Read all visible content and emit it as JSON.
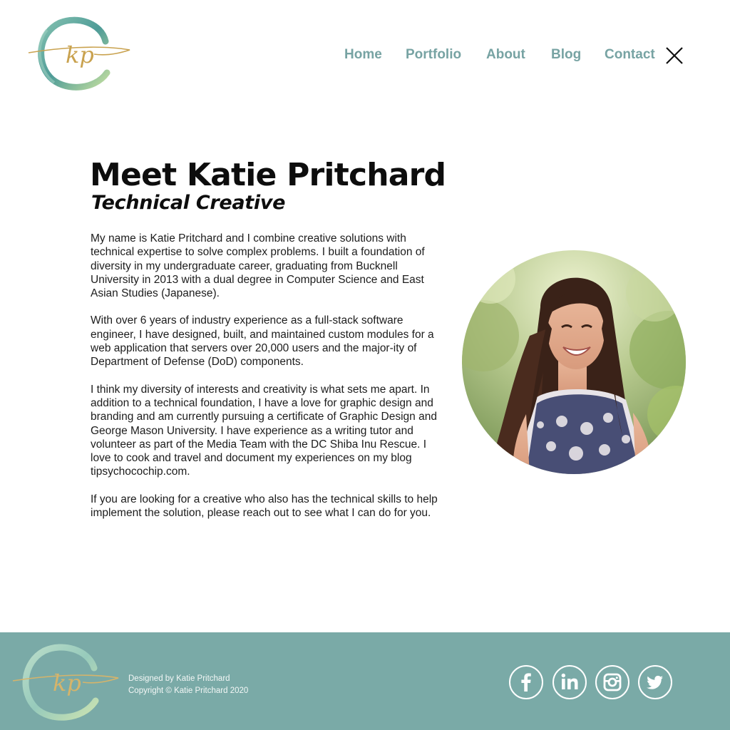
{
  "logo": {
    "monogram": "kp"
  },
  "nav": {
    "items": [
      {
        "label": "Home"
      },
      {
        "label": "Portfolio"
      },
      {
        "label": "About"
      },
      {
        "label": "Blog"
      },
      {
        "label": "Contact"
      }
    ],
    "close_icon": "close-icon"
  },
  "main": {
    "title": "Meet Katie Pritchard",
    "subtitle": "Technical Creative",
    "paragraphs": [
      "My name is Katie Pritchard and I combine creative solutions with technical expertise to solve complex problems.  I built a foundation of diversity in my undergraduate career, graduating from Bucknell University in 2013 with a dual degree in Computer Science and East Asian Studies (Japanese).",
      "With over 6 years of industry experience as a full-stack software engineer, I have designed, built, and maintained custom modules for a web application that servers over 20,000 users and the major-ity of Department of Defense (DoD) components.",
      "I think my diversity of interests and creativity is what sets me apart. In addition to a technical foundation, I have a love for graphic design and branding and am currently pursuing a certificate of Graphic Design and George Mason University.  I have experience as a writing tutor and volunteer as part of the Media Team with the DC Shiba Inu Rescue.  I love to cook and travel and document my experiences on my blog tipsychocochip.com.",
      "If you are looking for a creative who also has the technical skills to help implement the solution, please reach out to see what I can do for you."
    ]
  },
  "footer": {
    "designed_by": "Designed by Katie Pritchard",
    "copyright": "Copyright © Katie Pritchard 2020",
    "social": [
      "facebook-icon",
      "linkedin-icon",
      "instagram-icon",
      "twitter-icon"
    ]
  },
  "colors": {
    "accent": "#77a3a3",
    "footer_bg": "#7aaaa7",
    "gold": "#c9a24f",
    "teal_ring": "#4f9c90"
  }
}
